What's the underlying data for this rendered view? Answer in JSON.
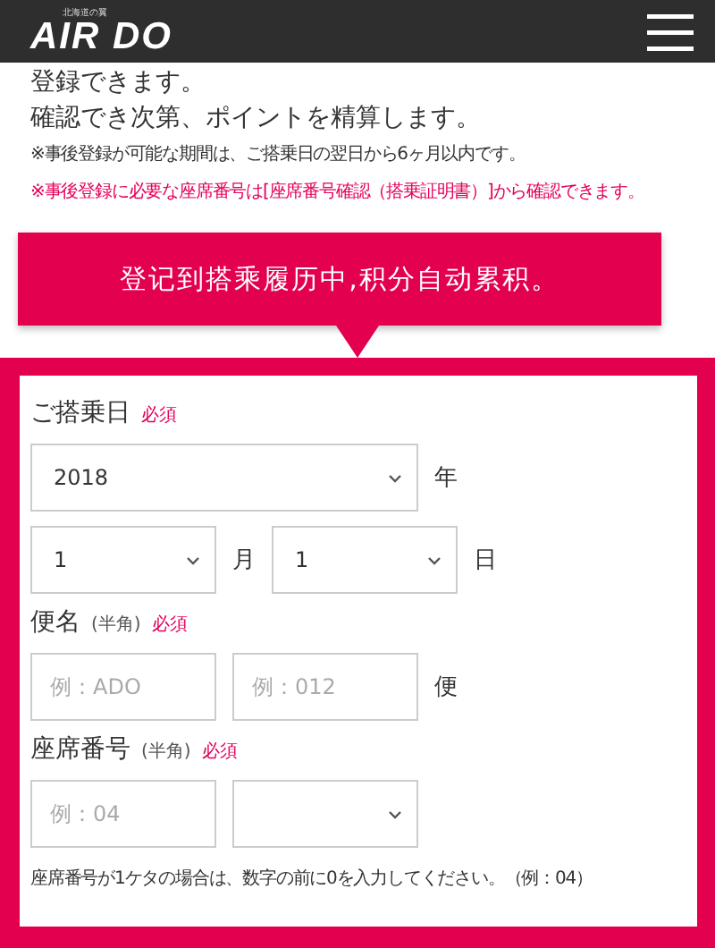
{
  "header": {
    "tagline": "北海道の翼",
    "logo": "AIR DO"
  },
  "intro": [
    "登録できます。",
    "確認でき次第、ポイントを精算します。"
  ],
  "notes": [
    {
      "text": "※事後登録が可能な期間は、ご搭乗日の翌日から6ヶ月以内です。",
      "kind": "plain"
    },
    {
      "text": "※事後登録に必要な座席番号は[座席番号確認（搭乗証明書）]から確認できます。",
      "kind": "alert"
    }
  ],
  "banner": "登记到搭乘履历中,积分自动累积。",
  "form": {
    "sections": [
      {
        "label": "ご搭乗日",
        "required": "必須",
        "rows": [
          [
            {
              "kind": "wideselect",
              "value": "2018"
            },
            {
              "kind": "unit",
              "text": "年"
            }
          ],
          [
            {
              "kind": "select",
              "value": "1"
            },
            {
              "kind": "unit",
              "text": "月"
            },
            {
              "kind": "select",
              "value": "1"
            },
            {
              "kind": "unit",
              "text": "日"
            }
          ]
        ]
      },
      {
        "label": "便名",
        "sub": "(半角)",
        "required": "必須",
        "rows": [
          [
            {
              "kind": "input",
              "placeholder": "例：ADO"
            },
            {
              "kind": "input",
              "placeholder": "例：012"
            },
            {
              "kind": "unit",
              "text": "便"
            }
          ]
        ]
      },
      {
        "label": "座席番号",
        "sub": "(半角)",
        "required": "必須",
        "rows": [
          [
            {
              "kind": "input",
              "placeholder": "例：04"
            },
            {
              "kind": "select"
            }
          ]
        ]
      }
    ],
    "footnote": "座席番号が1ケタの場合は、数字の前に0を入力してください。（例：04）"
  }
}
